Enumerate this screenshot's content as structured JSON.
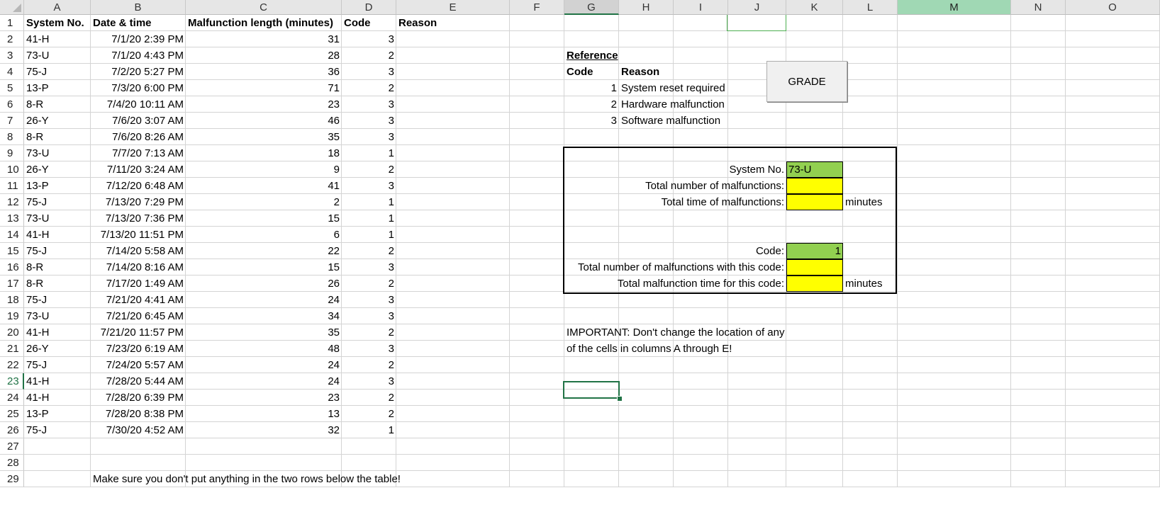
{
  "columns": [
    "A",
    "B",
    "C",
    "D",
    "E",
    "F",
    "G",
    "H",
    "I",
    "J",
    "K",
    "L",
    "M",
    "N",
    "O"
  ],
  "rows": [
    "1",
    "2",
    "3",
    "4",
    "5",
    "6",
    "7",
    "8",
    "9",
    "10",
    "11",
    "12",
    "13",
    "14",
    "15",
    "16",
    "17",
    "18",
    "19",
    "20",
    "21",
    "22",
    "23",
    "24",
    "25",
    "26",
    "27",
    "28",
    "29"
  ],
  "table": {
    "headers": [
      "System No.",
      "Date & time",
      "Malfunction length (minutes)",
      "Code",
      "Reason"
    ],
    "records": [
      [
        "41-H",
        "7/1/20 2:39 PM",
        "31",
        "3"
      ],
      [
        "73-U",
        "7/1/20 4:43 PM",
        "28",
        "2"
      ],
      [
        "75-J",
        "7/2/20 5:27 PM",
        "36",
        "3"
      ],
      [
        "13-P",
        "7/3/20 6:00 PM",
        "71",
        "2"
      ],
      [
        "8-R",
        "7/4/20 10:11 AM",
        "23",
        "3"
      ],
      [
        "26-Y",
        "7/6/20 3:07 AM",
        "46",
        "3"
      ],
      [
        "8-R",
        "7/6/20 8:26 AM",
        "35",
        "3"
      ],
      [
        "73-U",
        "7/7/20 7:13 AM",
        "18",
        "1"
      ],
      [
        "26-Y",
        "7/11/20 3:24 AM",
        "9",
        "2"
      ],
      [
        "13-P",
        "7/12/20 6:48 AM",
        "41",
        "3"
      ],
      [
        "75-J",
        "7/13/20 7:29 PM",
        "2",
        "1"
      ],
      [
        "73-U",
        "7/13/20 7:36 PM",
        "15",
        "1"
      ],
      [
        "41-H",
        "7/13/20 11:51 PM",
        "6",
        "1"
      ],
      [
        "75-J",
        "7/14/20 5:58 AM",
        "22",
        "2"
      ],
      [
        "8-R",
        "7/14/20 8:16 AM",
        "15",
        "3"
      ],
      [
        "8-R",
        "7/17/20 1:49 AM",
        "26",
        "2"
      ],
      [
        "75-J",
        "7/21/20 4:41 AM",
        "24",
        "3"
      ],
      [
        "73-U",
        "7/21/20 6:45 AM",
        "34",
        "3"
      ],
      [
        "41-H",
        "7/21/20 11:57 PM",
        "35",
        "2"
      ],
      [
        "26-Y",
        "7/23/20 6:19 AM",
        "48",
        "3"
      ],
      [
        "75-J",
        "7/24/20 5:57 AM",
        "24",
        "2"
      ],
      [
        "41-H",
        "7/28/20 5:44 AM",
        "24",
        "3"
      ],
      [
        "41-H",
        "7/28/20 6:39 PM",
        "23",
        "2"
      ],
      [
        "13-P",
        "7/28/20 8:38 PM",
        "13",
        "2"
      ],
      [
        "75-J",
        "7/30/20 4:52 AM",
        "32",
        "1"
      ]
    ],
    "footer_note": "Make sure you don't put anything in the two rows below the table!"
  },
  "reference": {
    "title": "Reference",
    "code_header": "Code",
    "reason_header": "Reason",
    "items": [
      {
        "code": "1",
        "reason": "System reset required"
      },
      {
        "code": "2",
        "reason": "Hardware malfunction"
      },
      {
        "code": "3",
        "reason": "Software malfunction"
      }
    ]
  },
  "grade_button": "GRADE",
  "summary": {
    "system_label": "System No.",
    "system_value": "73-U",
    "total_count_label": "Total number of malfunctions:",
    "total_time_label": "Total time of malfunctions:",
    "minutes_unit": "minutes",
    "code_label": "Code:",
    "code_value": "1",
    "code_count_label": "Total number of malfunctions with this code:",
    "code_time_label": "Total malfunction time for this code:",
    "colors": {
      "green": "#92d050",
      "yellow": "#ffff00"
    }
  },
  "important_note": {
    "line1": "IMPORTANT: Don't change the location of any",
    "line2": "of the cells in columns A through E!"
  }
}
